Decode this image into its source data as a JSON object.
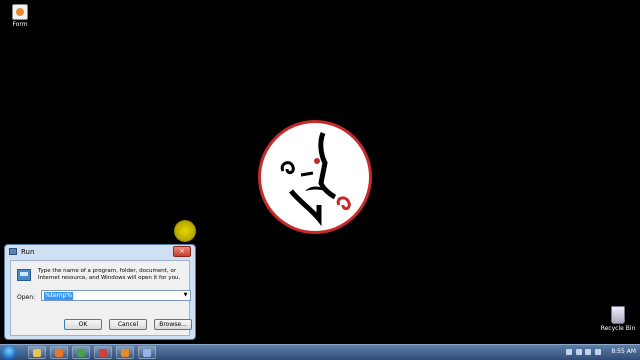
{
  "desktop": {
    "icons": [
      {
        "label": "Form"
      },
      {
        "label": "Recycle Bin"
      }
    ]
  },
  "run_dialog": {
    "title": "Run",
    "description": "Type the name of a program, folder, document, or Internet resource, and Windows will open it for you.",
    "open_label": "Open:",
    "open_value": "%temp%",
    "ok_label": "OK",
    "cancel_label": "Cancel",
    "browse_label": "Browse...",
    "close_glyph": "×"
  },
  "taskbar": {
    "items": [
      {
        "icon": "folder-icon",
        "color": "#e8c25a"
      },
      {
        "icon": "media-player-icon",
        "color": "#e8762a"
      },
      {
        "icon": "chrome-icon",
        "color": "#46a34a"
      },
      {
        "icon": "app-icon",
        "color": "#d04040"
      },
      {
        "icon": "form-app-icon",
        "color": "#e88a2a"
      },
      {
        "icon": "run-window-icon",
        "color": "#8fb6e8"
      }
    ],
    "clock": "8:55 AM"
  },
  "colors": {
    "desktop_bg": "#000000",
    "logo_ring": "#c62a2a",
    "taskbar": "#2e4b75"
  }
}
